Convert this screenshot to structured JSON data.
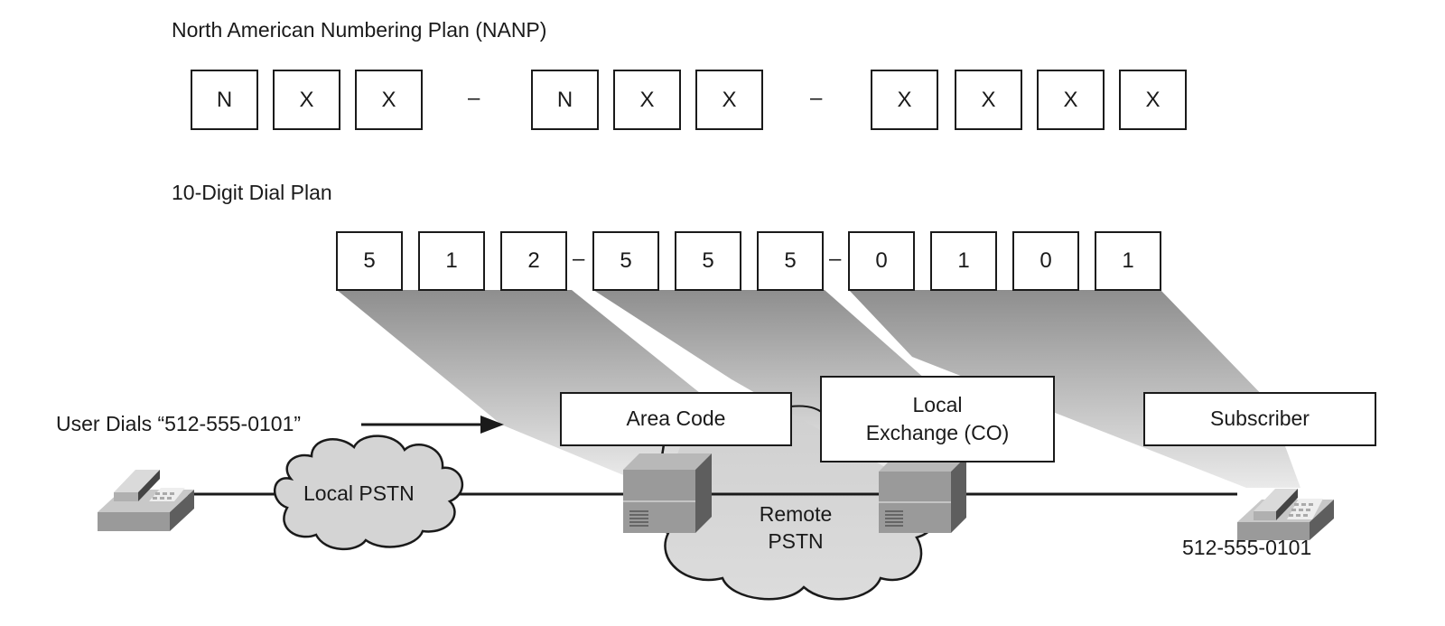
{
  "nanp": {
    "title": "North American Numbering Plan (NANP)",
    "groups": [
      [
        "N",
        "X",
        "X"
      ],
      [
        "N",
        "X",
        "X"
      ],
      [
        "X",
        "X",
        "X",
        "X"
      ]
    ],
    "separator": "–"
  },
  "dial_plan": {
    "title": "10-Digit Dial Plan",
    "groups": [
      [
        "5",
        "1",
        "2"
      ],
      [
        "5",
        "5",
        "5"
      ],
      [
        "0",
        "1",
        "0",
        "1"
      ]
    ],
    "separator": "–"
  },
  "labels": {
    "area_code": "Area Code",
    "local_exchange_line1": "Local",
    "local_exchange_line2": "Exchange (CO)",
    "subscriber": "Subscriber"
  },
  "network": {
    "user_dials": "User Dials “512-555-0101”",
    "local_pstn": "Local PSTN",
    "remote_pstn_line1": "Remote",
    "remote_pstn_line2": "PSTN",
    "destination_number": "512-555-0101"
  },
  "icons": {
    "source_phone": "telephone-icon",
    "destination_phone": "telephone-icon",
    "area_code_switch": "switch-icon",
    "local_exchange_switch": "switch-icon",
    "local_cloud": "cloud-icon",
    "remote_cloud": "cloud-icon",
    "dial_arrow": "arrow-right-icon"
  },
  "colors": {
    "beam_top": "#8e8e8e",
    "beam_bottom": "#e4e4e4",
    "cloud_fill": "#d4d4d4",
    "device_front": "#9a9a9a",
    "device_side": "#5e5e5e",
    "device_top": "#b8b8b8",
    "line": "#1a1a1a"
  }
}
